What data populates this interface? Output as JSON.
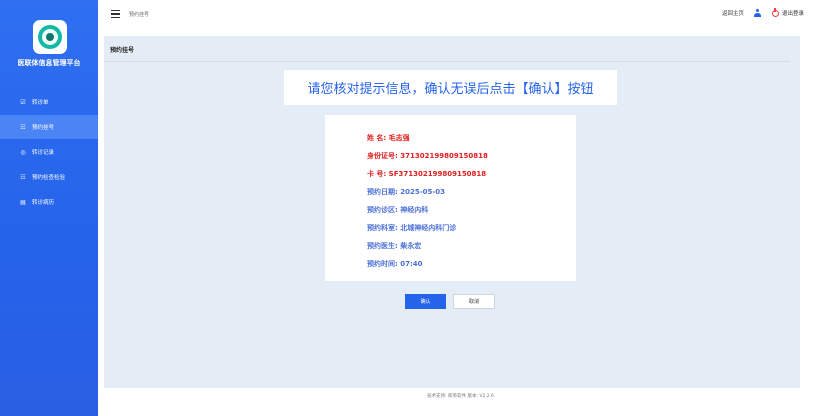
{
  "app": {
    "platform_name": "医联体信息管理平台"
  },
  "sidebar": {
    "items": [
      {
        "label": "转诊单",
        "icon": "form-icon",
        "active": false
      },
      {
        "label": "预约挂号",
        "icon": "register-icon",
        "active": true
      },
      {
        "label": "转诊记录",
        "icon": "record-icon",
        "active": false
      },
      {
        "label": "预约检查检验",
        "icon": "exam-icon",
        "active": false
      },
      {
        "label": "转诊病历",
        "icon": "case-icon",
        "active": false
      }
    ]
  },
  "header": {
    "breadcrumb": "预约挂号",
    "home_label": "返回主页",
    "logout_label": "退出登录"
  },
  "main": {
    "page_title": "预约挂号",
    "prompt": "请您核对提示信息，确认无误后点击【确认】按钮"
  },
  "info": {
    "name": "姓      名: 毛志强",
    "id_number": "身份证号: 371302199809150818",
    "card_number": "卡      号: SF371302199809150818",
    "date": "预约日期: 2025-05-03",
    "area": "预约诊区: 神经内科",
    "department": "预约科室: 北城神经内科门诊",
    "doctor": "预约医生: 柴永宏",
    "time": "预约时间: 07:40"
  },
  "buttons": {
    "confirm": "确认",
    "cancel": "取消"
  },
  "footer": {
    "text": "技术支持: 郎英软件  版本: V2.2.6"
  },
  "colors": {
    "primary": "#2563eb",
    "sidebar_active": "#4b84f5",
    "main_bg": "#e4ecf5",
    "alert_red": "#e11d1d",
    "info_blue": "#4a6fd8"
  }
}
